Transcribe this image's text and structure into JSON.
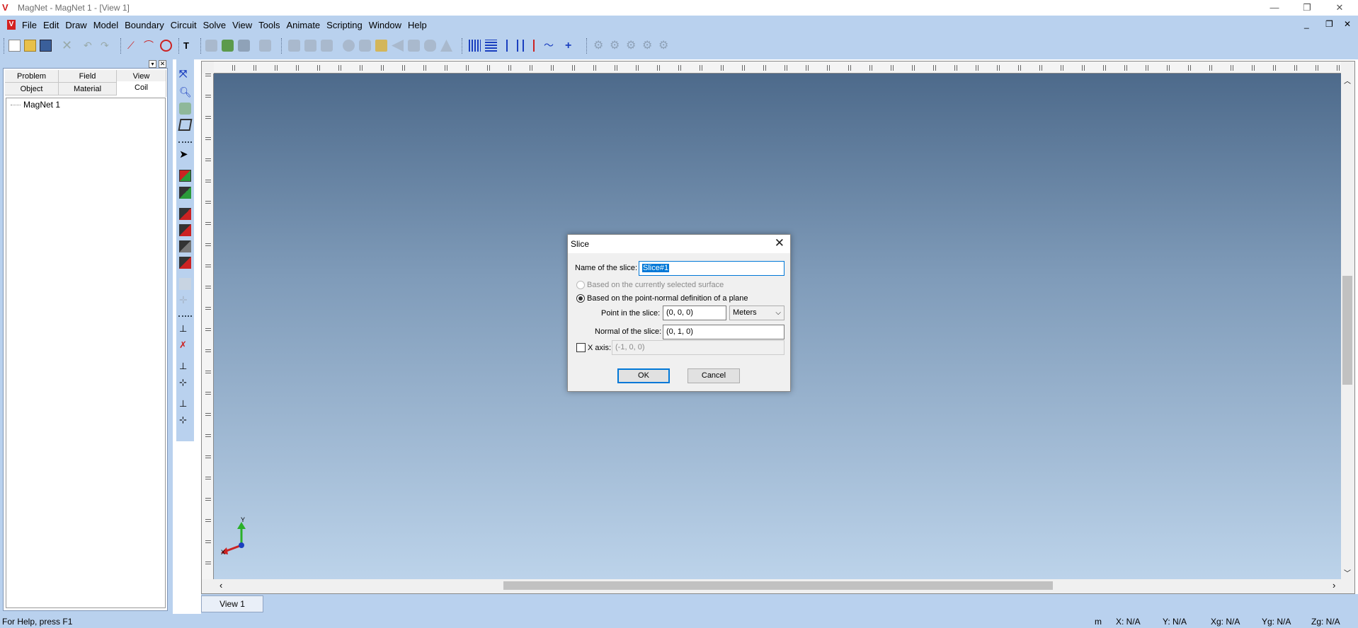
{
  "window": {
    "title": "MagNet - MagNet 1 - [View 1]",
    "controls": {
      "minimize": "—",
      "restore": "❐",
      "close": "✕"
    }
  },
  "menu": {
    "items": [
      "File",
      "Edit",
      "Draw",
      "Model",
      "Boundary",
      "Circuit",
      "Solve",
      "View",
      "Tools",
      "Animate",
      "Scripting",
      "Window",
      "Help"
    ],
    "mdi_controls": {
      "minimize": "_",
      "restore": "❐",
      "close": "✕"
    }
  },
  "left_panel": {
    "tabs_row1": [
      "Problem",
      "Field",
      "View"
    ],
    "tabs_row2": [
      "Object",
      "Material",
      "Coil"
    ],
    "selected_tab": "Coil",
    "tree_items": [
      "MagNet 1"
    ]
  },
  "view": {
    "tab_label": "View 1",
    "axis_y": "Y",
    "axis_x": "X"
  },
  "dialog": {
    "title": "Slice",
    "name_label": "Name of the slice:",
    "name_value": "Slice#1",
    "option_surface": "Based on the currently selected surface",
    "option_plane": "Based on the point-normal definition of a plane",
    "point_label": "Point in the slice:",
    "point_value": "(0, 0, 0)",
    "units_value": "Meters",
    "normal_label": "Normal of the slice:",
    "normal_value": "(0, 1, 0)",
    "xaxis_label": "X axis:",
    "xaxis_value": "(-1, 0, 0)",
    "ok_label": "OK",
    "cancel_label": "Cancel"
  },
  "status": {
    "help": "For Help, press F1",
    "unit": "m",
    "x": "X: N/A",
    "y": "Y: N/A",
    "xg": "Xg: N/A",
    "yg": "Yg: N/A",
    "zg": "Zg: N/A"
  },
  "colors": {
    "chrome": "#b9d1ee",
    "canvas_top": "#4d6a8b",
    "canvas_bottom": "#bcd3ea",
    "accent": "#0078d7"
  }
}
